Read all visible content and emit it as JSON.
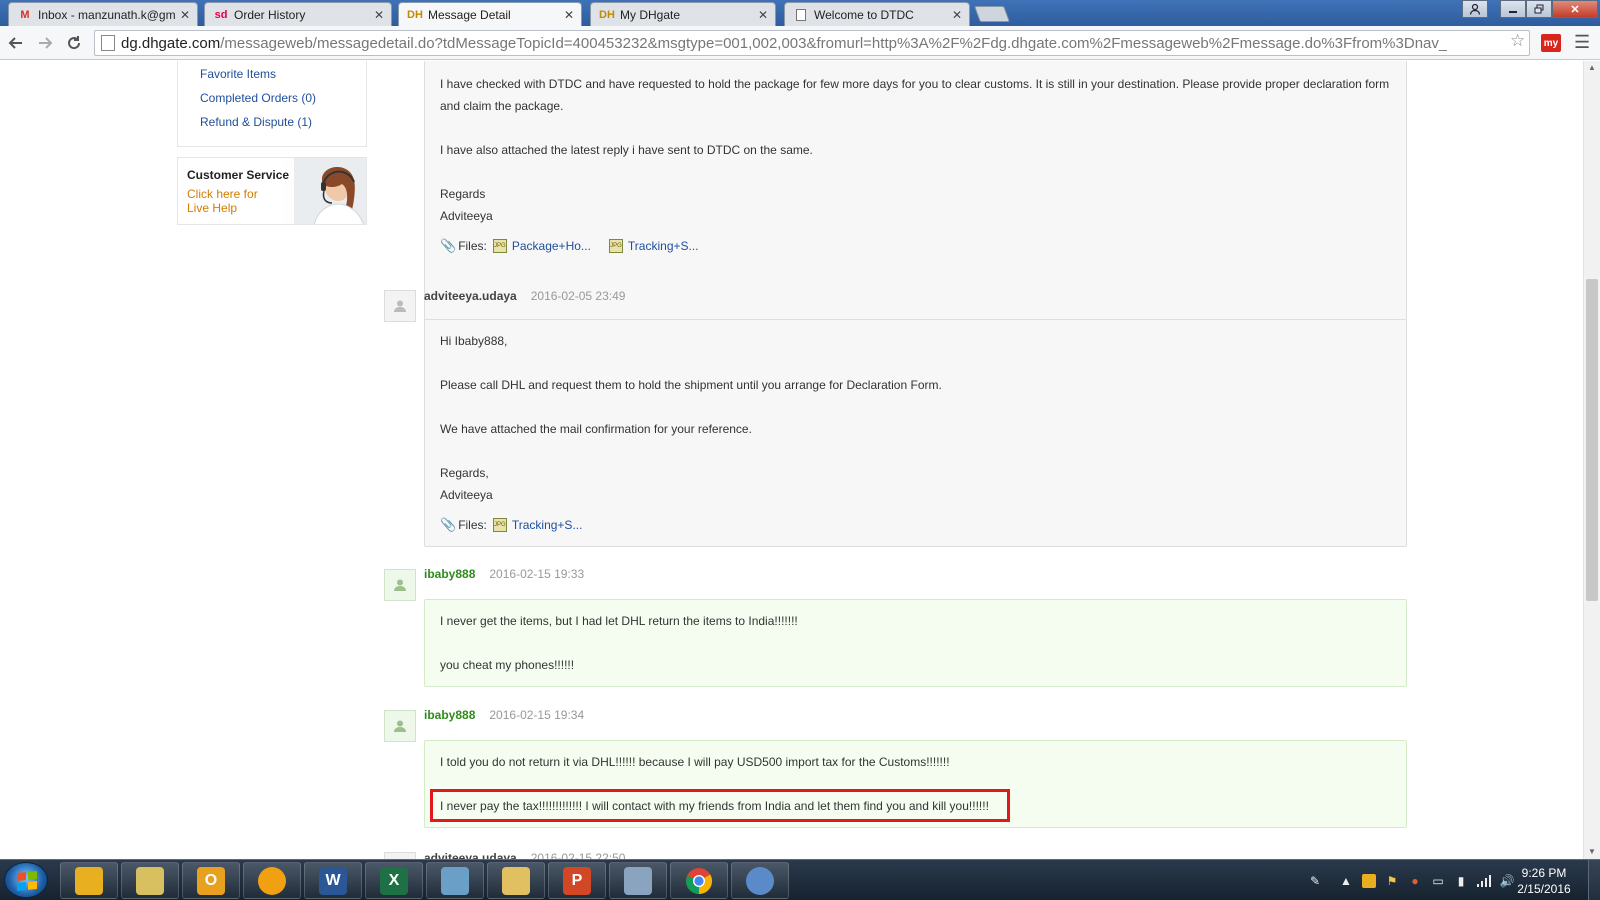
{
  "browser": {
    "tabs": [
      {
        "title": "Inbox - manzunath.k@gm",
        "favicon": "M",
        "favicon_color": "#d93025"
      },
      {
        "title": "Order History",
        "favicon": "sd",
        "favicon_color": "#e40046"
      },
      {
        "title": "Message Detail",
        "favicon": "DH",
        "favicon_color": "#e0a100"
      },
      {
        "title": "My DHgate",
        "favicon": "DH",
        "favicon_color": "#e0a100"
      },
      {
        "title": "Welcome to DTDC",
        "favicon": "",
        "favicon_color": "#888888"
      }
    ],
    "close_glyph": "✕",
    "url_host": "dg.dhgate.com",
    "url_path": "/messageweb/messagedetail.do?tdMessageTopicId=400453232&msgtype=001,002,003&fromurl=http%3A%2F%2Fdg.dhgate.com%2Fmessageweb%2Fmessage.do%3Ffrom%3Dnav_",
    "ext_label": "my"
  },
  "sidebar": {
    "links": [
      "Favorite Items",
      "Completed Orders (0)",
      "Refund & Dispute (1)"
    ],
    "customer_service": {
      "title": "Customer Service",
      "subtitle": "Click here for Live Help"
    }
  },
  "messages": [
    {
      "author": "",
      "time": "",
      "role": "seller",
      "paragraphs": [
        "I have checked with DTDC and have requested to hold the package for few more days for you to clear customs. It is still in your destination. Please provide proper declaration form and claim the package.",
        "I have also attached the latest reply i have sent to DTDC on the same.",
        "Regards",
        "Adviteeya"
      ],
      "files_label": "Files:",
      "files": [
        "Package+Ho...",
        "Tracking+S..."
      ]
    },
    {
      "author": "adviteeya.udaya",
      "time": "2016-02-05 23:49",
      "role": "seller",
      "paragraphs": [
        "Hi Ibaby888,",
        "Please call DHL and request them to hold the shipment until you arrange for Declaration Form.",
        "We have attached the mail confirmation for your reference.",
        "Regards,",
        "Adviteeya"
      ],
      "files_label": "Files:",
      "files": [
        "Tracking+S..."
      ]
    },
    {
      "author": "ibaby888",
      "time": "2016-02-15 19:33",
      "role": "buyer",
      "paragraphs": [
        "I never get the items, but I had let DHL return the items to India!!!!!!!",
        "you cheat my phones!!!!!!"
      ]
    },
    {
      "author": "ibaby888",
      "time": "2016-02-15 19:34",
      "role": "buyer",
      "paragraphs": [
        "I told you do not return it via DHL!!!!!! because I will pay USD500 import tax for the Customs!!!!!!!",
        "I never pay the tax!!!!!!!!!!!!! I will contact with my friends from India and let them find you and kill you!!!!!!"
      ]
    },
    {
      "author": "adviteeya.udaya",
      "time": "2016-02-15 22:50",
      "role": "seller",
      "paragraphs": []
    }
  ],
  "taskbar": {
    "apps": [
      {
        "name": "file-manager",
        "color": "#e8b020",
        "glyph": ""
      },
      {
        "name": "folder",
        "color": "#d8c060",
        "glyph": ""
      },
      {
        "name": "outlook",
        "color": "#e8a020",
        "glyph": "O"
      },
      {
        "name": "app-orange",
        "color": "#f0a010",
        "glyph": ""
      },
      {
        "name": "word",
        "color": "#2b5797",
        "glyph": "W"
      },
      {
        "name": "excel",
        "color": "#1e7145",
        "glyph": "X"
      },
      {
        "name": "notepad",
        "color": "#6aa0c8",
        "glyph": ""
      },
      {
        "name": "explorer",
        "color": "#e0c060",
        "glyph": ""
      },
      {
        "name": "powerpoint",
        "color": "#d24726",
        "glyph": "P"
      },
      {
        "name": "calculator",
        "color": "#8aa4c0",
        "glyph": ""
      },
      {
        "name": "chrome",
        "color": "#4caf50",
        "glyph": ""
      },
      {
        "name": "paint",
        "color": "#5a8ac8",
        "glyph": ""
      }
    ],
    "clock_time": "9:26 PM",
    "clock_date": "2/15/2016"
  }
}
